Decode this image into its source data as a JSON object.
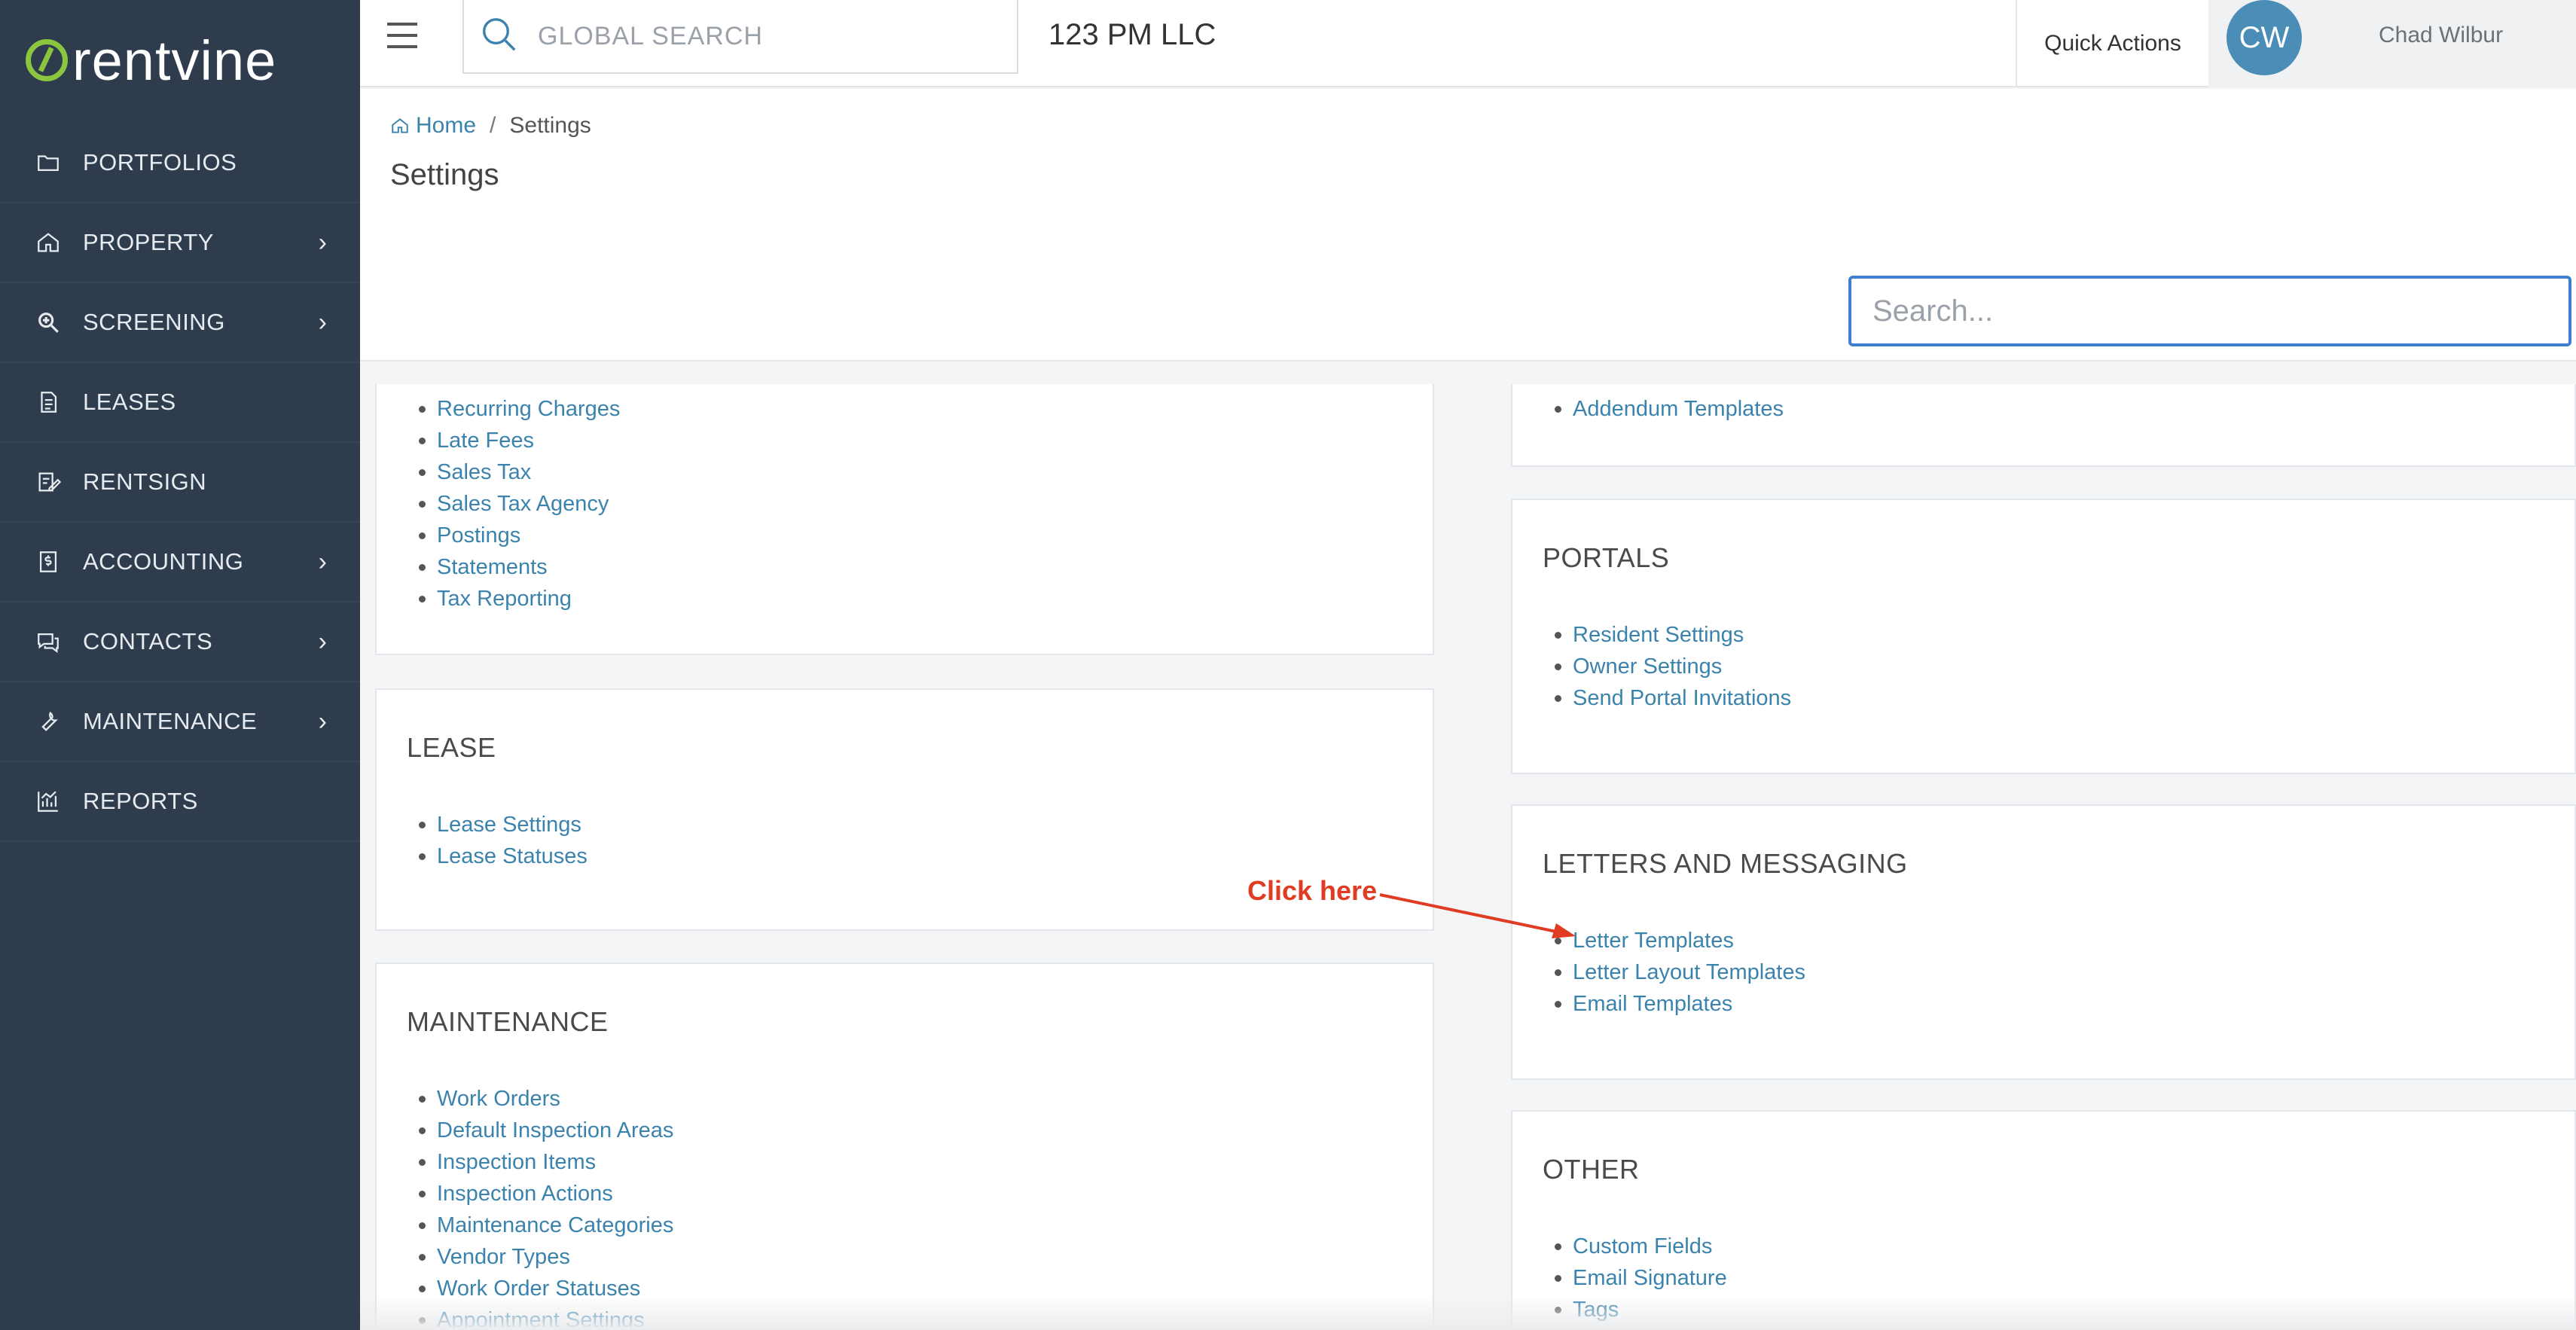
{
  "sidebar": {
    "logo_text": "rentvine",
    "items": [
      {
        "label": "PORTFOLIOS",
        "icon": "folder-icon",
        "has_submenu": false
      },
      {
        "label": "PROPERTY",
        "icon": "home-icon",
        "has_submenu": true
      },
      {
        "label": "SCREENING",
        "icon": "search-plus-icon",
        "has_submenu": true
      },
      {
        "label": "LEASES",
        "icon": "document-icon",
        "has_submenu": false
      },
      {
        "label": "RENTSIGN",
        "icon": "sign-icon",
        "has_submenu": false
      },
      {
        "label": "ACCOUNTING",
        "icon": "dollar-file-icon",
        "has_submenu": true
      },
      {
        "label": "CONTACTS",
        "icon": "chat-icon",
        "has_submenu": true
      },
      {
        "label": "MAINTENANCE",
        "icon": "wrench-icon",
        "has_submenu": true
      },
      {
        "label": "REPORTS",
        "icon": "chart-icon",
        "has_submenu": false
      }
    ],
    "chevron": "›"
  },
  "topbar": {
    "search_placeholder": "GLOBAL SEARCH",
    "company": "123 PM LLC",
    "quick_actions": "Quick Actions",
    "avatar_initials": "CW",
    "user_name": "Chad Wilbur"
  },
  "page": {
    "breadcrumb_home": "Home",
    "breadcrumb_sep": "/",
    "breadcrumb_current": "Settings",
    "title": "Settings",
    "search_placeholder": "Search..."
  },
  "cards": {
    "accounting_partial": {
      "links": [
        "Recurring Charges",
        "Late Fees",
        "Sales Tax",
        "Sales Tax Agency",
        "Postings",
        "Statements",
        "Tax Reporting"
      ]
    },
    "lease": {
      "title": "LEASE",
      "links": [
        "Lease Settings",
        "Lease Statuses"
      ]
    },
    "maintenance": {
      "title": "MAINTENANCE",
      "links": [
        "Work Orders",
        "Default Inspection Areas",
        "Inspection Items",
        "Inspection Actions",
        "Maintenance Categories",
        "Vendor Types",
        "Work Order Statuses",
        "Appointment Settings"
      ]
    },
    "addendum_partial": {
      "links": [
        "Addendum Templates"
      ]
    },
    "portals": {
      "title": "PORTALS",
      "links": [
        "Resident Settings",
        "Owner Settings",
        "Send Portal Invitations"
      ]
    },
    "letters": {
      "title": "LETTERS AND MESSAGING",
      "links": [
        "Letter Templates",
        "Letter Layout Templates",
        "Email Templates"
      ]
    },
    "other": {
      "title": "OTHER",
      "links": [
        "Custom Fields",
        "Email Signature",
        "Tags"
      ]
    }
  },
  "annotation": {
    "text": "Click here",
    "color": "#e03c23"
  },
  "colors": {
    "sidebar_bg": "#2e3c4d",
    "link": "#3b83ad",
    "logo_accent": "#8cc63f",
    "avatar_bg": "#4a8db7"
  }
}
